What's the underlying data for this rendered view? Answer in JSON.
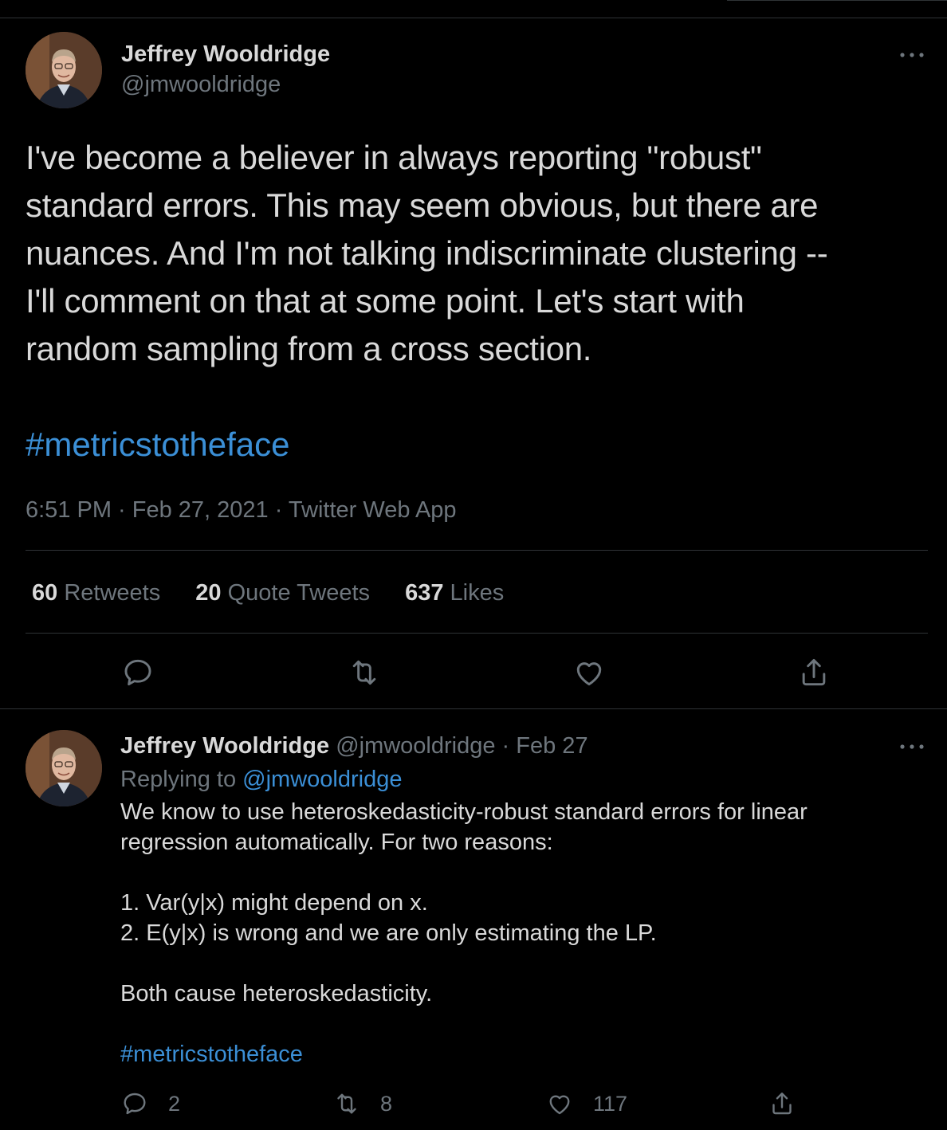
{
  "tweet": {
    "author": {
      "name": "Jeffrey Wooldridge",
      "handle": "@jmwooldridge"
    },
    "more_icon": "more-horizontal-icon",
    "lines": [
      "I've become a believer in always reporting \"robust\"",
      "standard errors. This may seem obvious, but there are",
      "nuances. And I'm not talking indiscriminate clustering --",
      "I'll comment on that at some point. Let's start with",
      "random sampling from a cross section."
    ],
    "hashtag": "#metricstotheface",
    "meta": "6:51 PM · Feb 27, 2021 · Twitter Web App",
    "stats": {
      "retweets": {
        "value": "60",
        "label": "Retweets"
      },
      "quote_tweets": {
        "value": "20",
        "label": "Quote Tweets"
      },
      "likes": {
        "value": "637",
        "label": "Likes"
      }
    },
    "actions": [
      "reply-icon",
      "retweet-icon",
      "like-icon",
      "share-icon"
    ]
  },
  "reply": {
    "author": {
      "name": "Jeffrey Wooldridge",
      "handle": "@jmwooldridge"
    },
    "separator": "·",
    "date": "Feb 27",
    "replying_prefix": "Replying to",
    "replying_to": "@jmwooldridge",
    "lines": [
      "We know to use heteroskedasticity-robust standard errors for linear",
      "regression automatically. For two reasons:",
      "",
      "1. Var(y|x) might depend on x.",
      "2. E(y|x) is wrong and we are only estimating the LP.",
      "",
      "Both cause heteroskedasticity.",
      ""
    ],
    "hashtag": "#metricstotheface",
    "counts": {
      "replies": "2",
      "retweets": "8",
      "likes": "117"
    }
  },
  "colors": {
    "background": "#000000",
    "text": "#d9d9d9",
    "muted": "#6e767d",
    "link": "#3b8fd6",
    "divider": "#2f3336"
  }
}
